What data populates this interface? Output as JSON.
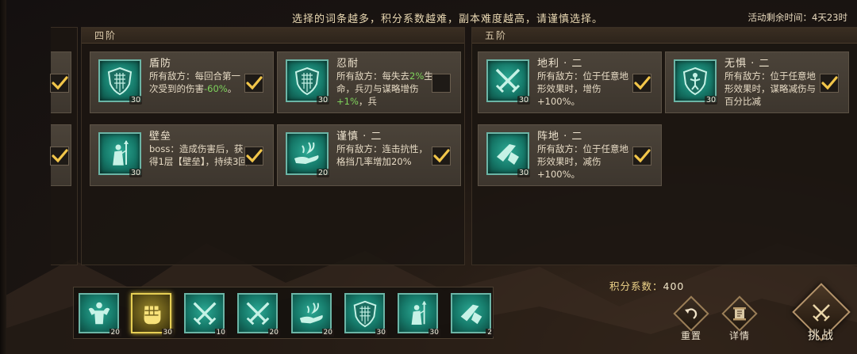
{
  "header": {
    "hint": "选择的词条越多，积分系数越难，副本难度越高，请谨慎选择。",
    "timer_label": "活动剩余时间：",
    "timer_value": "4天23时"
  },
  "panels": {
    "tier4": {
      "label": "四阶"
    },
    "tier5": {
      "label": "五阶"
    }
  },
  "cards": {
    "dunfang": {
      "title": "盾防",
      "desc_a": "所有敌方：每回合第一次受到的伤害",
      "desc_green": "-60%",
      "desc_b": "。",
      "level": "30",
      "checked": true,
      "icon": "shield-icon"
    },
    "rennai": {
      "title": "忍耐",
      "desc_a": "所有敌方：每失去",
      "desc_green": "2%",
      "desc_b": "生命，兵刃与谋略增伤",
      "desc_green2": "+1%",
      "desc_c": "，兵",
      "level": "30",
      "checked": false,
      "icon": "shield-icon"
    },
    "bilei": {
      "title": "壁垒",
      "desc": "boss：造成伤害后，获得1层【壁垒】，持续3回",
      "level": "30",
      "checked": true,
      "icon": "warrior-spear-icon"
    },
    "jinshen": {
      "title": "谨慎 · 二",
      "desc": "所有敌方：连击抗性，格挡几率增加20%",
      "level": "20",
      "checked": true,
      "icon": "hand-flame-icon"
    },
    "dili": {
      "title": "地利 · 二",
      "desc": "所有敌方：位于任意地形效果时，增伤+100%。",
      "level": "30",
      "checked": true,
      "icon": "crossed-swords-icon"
    },
    "wuju": {
      "title": "无惧 · 二",
      "desc": "所有敌方：位于任意地形效果时，谋略减伤与百分比减",
      "level": "30",
      "checked": true,
      "icon": "figure-shield-icon"
    },
    "zhendi": {
      "title": "阵地 · 二",
      "desc": "所有敌方：位于任意地形效果时，减伤+100%。",
      "level": "30",
      "checked": true,
      "icon": "broken-sword-icon"
    }
  },
  "tray": {
    "slots": [
      {
        "icon": "strongman-icon",
        "level": "20"
      },
      {
        "icon": "fist-icon",
        "level": "30"
      },
      {
        "icon": "crossed-swords-icon",
        "level": "10"
      },
      {
        "icon": "crossed-swords-icon",
        "level": "20"
      },
      {
        "icon": "hand-flame-icon",
        "level": "20"
      },
      {
        "icon": "shield-icon",
        "level": "30"
      },
      {
        "icon": "warrior-spear-icon",
        "level": "30"
      },
      {
        "icon": "broken-sword-icon",
        "level": "2"
      }
    ]
  },
  "score": {
    "label": "积分系数：",
    "value": "400"
  },
  "buttons": {
    "reset": "重置",
    "details": "详情",
    "challenge": "挑战"
  },
  "colors": {
    "accent_green": "#7fd35c",
    "icon_teal": "#1f8f7d",
    "gold": "#e6cf55"
  }
}
